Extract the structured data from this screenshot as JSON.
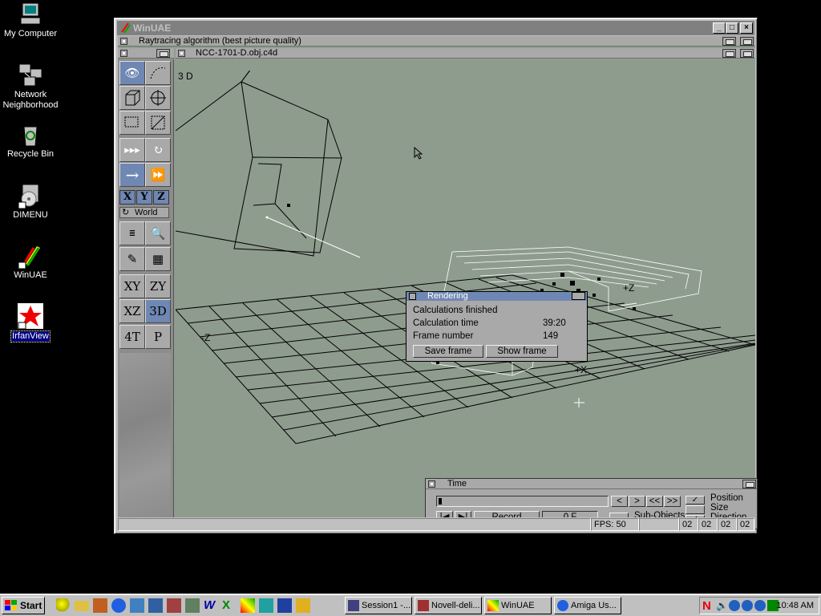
{
  "desktop": {
    "icons": [
      {
        "label": "My Computer"
      },
      {
        "label": "Network Neighborhood"
      },
      {
        "label": "Recycle Bin"
      },
      {
        "label": "DIMENU"
      },
      {
        "label": "WinUAE"
      },
      {
        "label": "IrfanView"
      }
    ]
  },
  "window": {
    "title": "WinUAE",
    "render_bar": "Raytracing algorithm (best picture quality)",
    "doc_bar": "NCC-1701-D.obj.c4d",
    "view_label": "3 D"
  },
  "toolbar": {
    "axis_x": "X",
    "axis_y": "Y",
    "axis_z": "Z",
    "world_label": "World",
    "view_xy": "XY",
    "view_zy": "ZY",
    "view_xz": "XZ",
    "view_3d": "3D",
    "view_4t": "4T",
    "view_p": "P"
  },
  "viewport": {
    "axis_neg_z": "-Z",
    "axis_pos_x": "+X",
    "axis_pos_z": "+Z"
  },
  "rendering_dialog": {
    "title": "Rendering",
    "status": "Calculations finished",
    "calc_time_label": "Calculation time",
    "calc_time_value": "39:20",
    "frame_label": "Frame number",
    "frame_value": "149",
    "save_frame": "Save frame",
    "show_frame": "Show frame"
  },
  "time_window": {
    "title": "Time",
    "btn_prev": "<",
    "btn_next": ">",
    "btn_rew": "<<",
    "btn_ff": ">>",
    "record": "Record",
    "frame_field": "0 F",
    "sub_objects": "Sub-Objects",
    "opt_position": "Position",
    "opt_size": "Size",
    "opt_direction": "Direction"
  },
  "statusbar": {
    "fps": "FPS: 50",
    "f1": "02",
    "f2": "02",
    "f3": "02",
    "f4": "02"
  },
  "taskbar": {
    "start": "Start",
    "tasks": [
      {
        "label": "Session1 -..."
      },
      {
        "label": "Novell-deli..."
      },
      {
        "label": "WinUAE"
      },
      {
        "label": "Amiga Us..."
      }
    ],
    "clock": "10:48 AM"
  },
  "colors": {
    "desktop_bg": "#000000",
    "amiga_blue": "#6f87b3",
    "viewport_bg": "#8e9c8e"
  }
}
